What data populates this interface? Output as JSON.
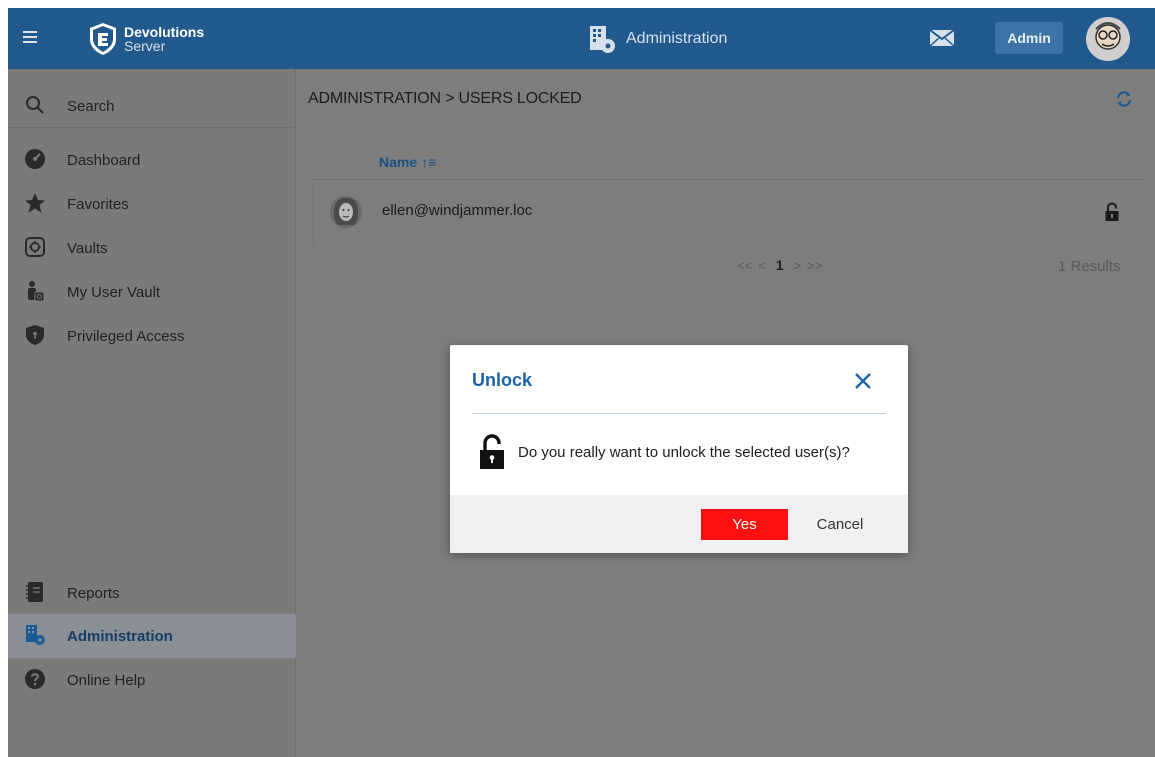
{
  "header": {
    "brand_line1": "Devolutions",
    "brand_line2": "Server",
    "section_title": "Administration",
    "admin_label": "Admin"
  },
  "sidebar": {
    "items": [
      {
        "label": "Search",
        "icon": "search-icon"
      },
      {
        "label": "Dashboard",
        "icon": "dashboard-icon"
      },
      {
        "label": "Favorites",
        "icon": "star-icon"
      },
      {
        "label": "Vaults",
        "icon": "vault-icon"
      },
      {
        "label": "My User Vault",
        "icon": "user-vault-icon"
      },
      {
        "label": "Privileged Access",
        "icon": "shield-icon"
      }
    ],
    "bottom_items": [
      {
        "label": "Reports",
        "icon": "reports-icon"
      },
      {
        "label": "Administration",
        "icon": "building-gear-icon",
        "active": true
      },
      {
        "label": "Online Help",
        "icon": "help-icon"
      }
    ]
  },
  "main": {
    "breadcrumb": "ADMINISTRATION > USERS LOCKED",
    "column_name": "Name",
    "rows": [
      {
        "user": "ellen@windjammer.loc"
      }
    ],
    "pager": {
      "first": "<<",
      "prev": "<",
      "current": "1",
      "next": ">",
      "last": ">>"
    },
    "results": "1 Results"
  },
  "dialog": {
    "title": "Unlock",
    "message": "Do you really want to unlock the selected user(s)?",
    "yes_label": "Yes",
    "cancel_label": "Cancel"
  },
  "colors": {
    "topbar": "#235a8e",
    "accent": "#1c63a8",
    "danger": "#ff1010"
  }
}
